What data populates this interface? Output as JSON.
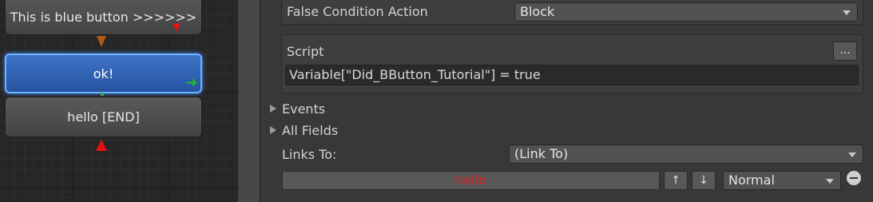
{
  "graph": {
    "nodes": [
      {
        "text": "This is blue button >>>>>>"
      },
      {
        "text": "ok!"
      },
      {
        "text": "hello [END]"
      }
    ]
  },
  "inspector": {
    "false_condition": {
      "label": "False Condition Action",
      "value": "Block"
    },
    "script": {
      "label": "Script",
      "ellipsis_label": "...",
      "value": "Variable[\"Did_BButton_Tutorial\"] = true"
    },
    "events_label": "Events",
    "all_fields_label": "All Fields",
    "links_to": {
      "label": "Links To:",
      "value": "(Link To)"
    },
    "link_row": {
      "target": "hello",
      "up_label": "↑",
      "down_label": "↓",
      "priority": "Normal"
    }
  },
  "colors": {
    "selected_node": "#2f62b8",
    "link_target_text": "#e01e1e",
    "panel_bg": "#383838",
    "canvas_bg": "#262626"
  }
}
